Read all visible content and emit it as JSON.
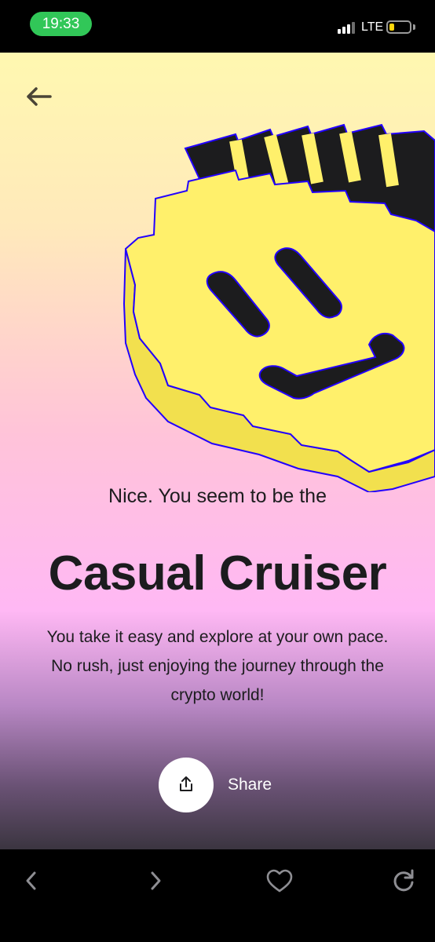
{
  "status_bar": {
    "time": "19:33",
    "network": "LTE"
  },
  "result": {
    "intro": "Nice. You seem to be the",
    "title": "Casual Cruiser",
    "description": "You take it easy and explore at your own pace. No rush, just enjoying the journey through the crypto world!",
    "share_label": "Share"
  },
  "colors": {
    "smiley_yellow": "#fff06b",
    "smiley_dark": "#1c1c1e",
    "outline": "#2200ff",
    "status_green": "#31c758"
  },
  "icons": {
    "back": "arrow-left-icon",
    "share": "share-icon",
    "browser_back": "chevron-left-icon",
    "browser_forward": "chevron-right-icon",
    "favorite": "heart-icon",
    "reload": "reload-icon"
  }
}
